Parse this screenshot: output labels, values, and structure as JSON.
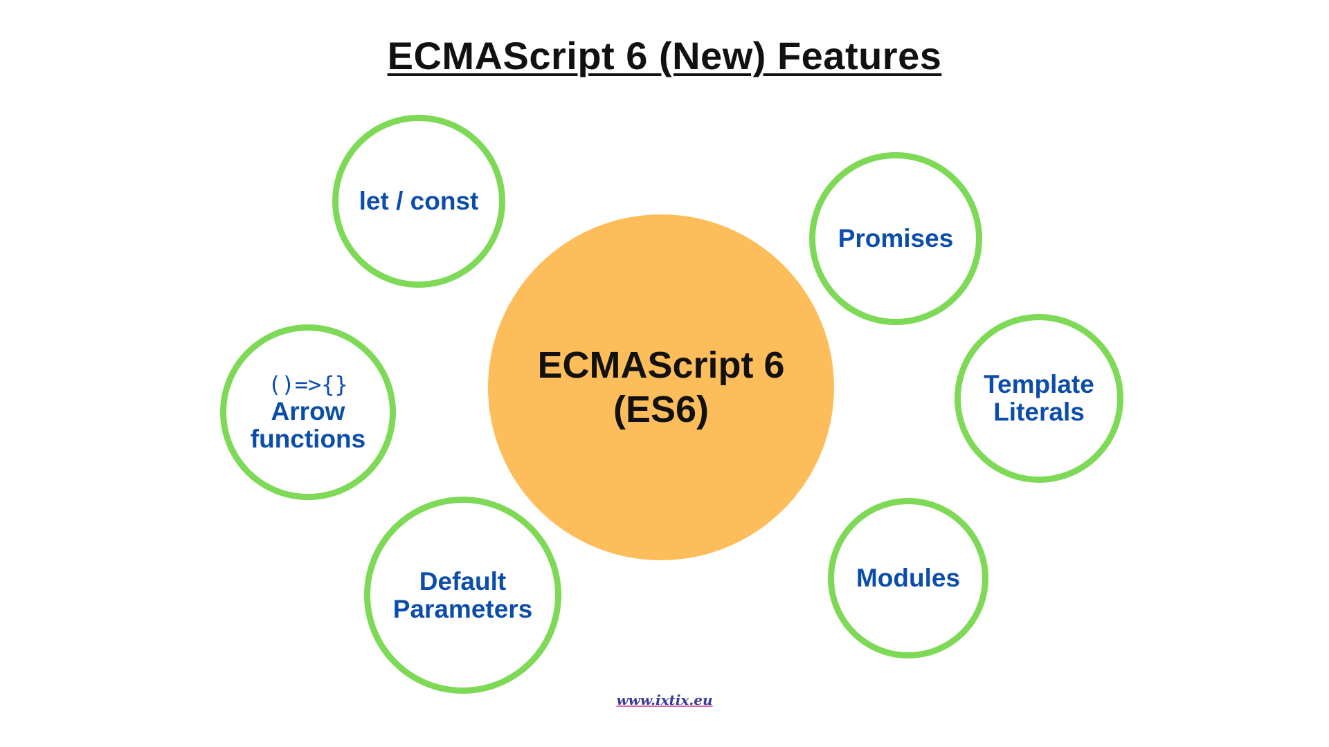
{
  "title": "ECMAScript 6 (New) Features",
  "center": {
    "line1": "ECMAScript 6",
    "line2": "(ES6)"
  },
  "nodes": {
    "let_const": {
      "label": "let / const"
    },
    "arrow": {
      "glyph": "()=>{}",
      "line1": "Arrow",
      "line2": "functions"
    },
    "default_params": {
      "line1": "Default",
      "line2": "Parameters"
    },
    "promises": {
      "label": "Promises"
    },
    "template_literals": {
      "line1": "Template",
      "line2": "Literals"
    },
    "modules": {
      "label": "Modules"
    }
  },
  "watermark": "www.ixtix.eu",
  "colors": {
    "center_fill": "#fdbd5b",
    "node_border": "#7ed957",
    "node_text": "#0c4dab",
    "title_text": "#111111"
  }
}
